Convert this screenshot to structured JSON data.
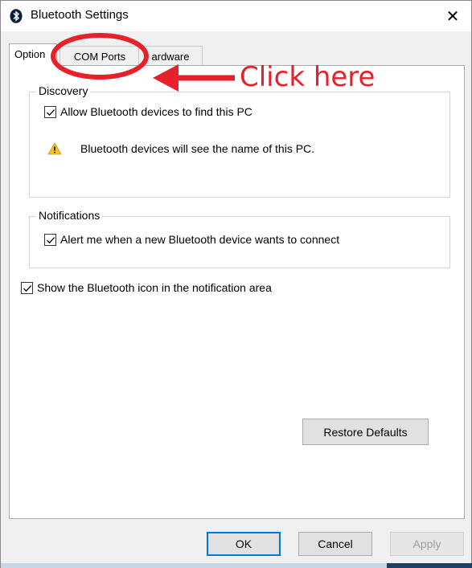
{
  "window": {
    "title": "Bluetooth Settings",
    "close_glyph": "✕"
  },
  "tabs": [
    {
      "label": "Options",
      "visible_label": "Option",
      "selected": true
    },
    {
      "label": "COM Ports",
      "selected": false
    },
    {
      "label": "Hardware",
      "visible_label": "ardware",
      "selected": false
    }
  ],
  "discovery": {
    "group_label": "Discovery",
    "allow_label": "Allow Bluetooth devices to find this PC",
    "allow_checked": true,
    "warning_text": "Bluetooth devices will see the name of this PC."
  },
  "notifications": {
    "group_label": "Notifications",
    "alert_label": "Alert me when a new Bluetooth device wants to connect",
    "alert_checked": true
  },
  "show_icon": {
    "label": "Show the Bluetooth icon in the notification area",
    "checked": true
  },
  "buttons": {
    "restore": "Restore Defaults",
    "ok": "OK",
    "cancel": "Cancel",
    "apply": "Apply"
  },
  "annotation": {
    "text": "Click here",
    "color": "#e8202a"
  },
  "colors": {
    "accent": "#0078d7",
    "bluetooth_icon_bg": "#0a1f3c"
  }
}
